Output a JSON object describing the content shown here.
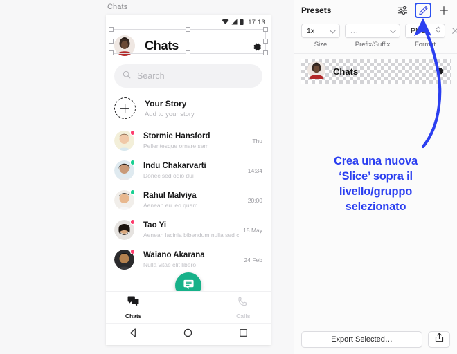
{
  "canvas": {
    "frame_label": "Chats",
    "statusbar": {
      "time": "17:13",
      "icons": [
        "wifi-icon",
        "signal-icon",
        "battery-icon"
      ]
    },
    "app_header": {
      "title": "Chats",
      "settings_icon": "gear-icon",
      "avatar": "avatar"
    },
    "search": {
      "placeholder": "Search",
      "icon": "search-icon"
    },
    "story": {
      "title": "Your Story",
      "subtitle": "Add to your story",
      "icon": "plus-icon"
    },
    "chats": [
      {
        "name": "Stormie Hansford",
        "message": "Pellentesque ornare sem",
        "time": "Thu",
        "dot": "#fd3e6e"
      },
      {
        "name": "Indu Chakarvarti",
        "message": "Donec sed odio dui",
        "time": "14:34",
        "dot": "#19d092"
      },
      {
        "name": "Rahul Malviya",
        "message": "Aenean eu leo quam",
        "time": "20:00",
        "dot": "#19d092"
      },
      {
        "name": "Tao Yi",
        "message": "Aenean lacinia bibendum nulla sed consectetur",
        "time": "15 May",
        "dot": "#fd3e6e"
      },
      {
        "name": "Waiano Akarana",
        "message": "Nulla vitae elit libero",
        "time": "24 Feb",
        "dot": "#fd3e6e"
      }
    ],
    "fab": {
      "icon": "chat-bubble-icon",
      "color": "#17b189"
    },
    "bottom_nav": [
      {
        "label": "Chats",
        "icon": "chats-icon",
        "active": true
      },
      {
        "label": "Calls",
        "icon": "phone-icon",
        "active": false
      }
    ],
    "android_nav": [
      "back-icon",
      "home-icon",
      "recents-icon"
    ]
  },
  "panel": {
    "title": "Presets",
    "header_icons": [
      "sliders-icon",
      "slice-tool-icon",
      "plus-icon"
    ],
    "selected_tool": "slice-tool-icon",
    "controls": [
      {
        "name": "size",
        "value": "1x",
        "label": "Size",
        "chevron": "chevron-down-icon"
      },
      {
        "name": "prefix-suffix",
        "value": "...",
        "label": "Prefix/Suffix",
        "chevron": "chevron-down-icon"
      },
      {
        "name": "format",
        "value": "PNG",
        "label": "Format",
        "chevron": "stepper-icon"
      }
    ],
    "remove_icon": "close-icon",
    "preview": {
      "title": "Chats",
      "settings_icon": "gear-icon",
      "avatar": "avatar"
    },
    "annotation": {
      "lines": [
        "Crea una nuova",
        "‘Slice’ sopra il",
        "livello/gruppo",
        "selezionato"
      ],
      "color": "#2b3ff0",
      "arrow": "curved-arrow-icon"
    },
    "footer": {
      "export_label": "Export Selected…",
      "share_icon": "share-icon"
    }
  }
}
